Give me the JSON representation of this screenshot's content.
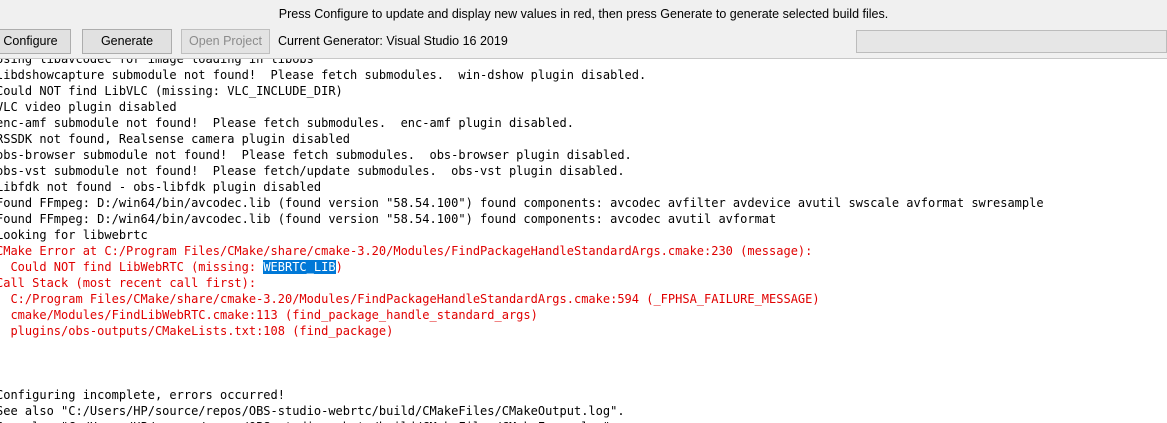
{
  "hint": "Press Configure to update and display new values in red, then press Generate to generate selected build files.",
  "toolbar": {
    "configure_label": "Configure",
    "generate_label": "Generate",
    "open_project_label": "Open Project",
    "current_generator": "Current Generator: Visual Studio 16 2019",
    "progress": 0
  },
  "output": {
    "lines": [
      {
        "text": "Using libavcodec for image loading in libobs",
        "style": "normal"
      },
      {
        "text": "libdshowcapture submodule not found!  Please fetch submodules.  win-dshow plugin disabled.",
        "style": "normal"
      },
      {
        "text": "Could NOT find LibVLC (missing: VLC_INCLUDE_DIR)",
        "style": "normal"
      },
      {
        "text": "VLC video plugin disabled",
        "style": "normal"
      },
      {
        "text": "enc-amf submodule not found!  Please fetch submodules.  enc-amf plugin disabled.",
        "style": "normal"
      },
      {
        "text": "RSSDK not found, Realsense camera plugin disabled",
        "style": "normal"
      },
      {
        "text": "obs-browser submodule not found!  Please fetch submodules.  obs-browser plugin disabled.",
        "style": "normal"
      },
      {
        "text": "obs-vst submodule not found!  Please fetch/update submodules.  obs-vst plugin disabled.",
        "style": "normal"
      },
      {
        "text": "Libfdk not found - obs-libfdk plugin disabled",
        "style": "normal"
      },
      {
        "text": "Found FFmpeg: D:/win64/bin/avcodec.lib (found version \"58.54.100\") found components: avcodec avfilter avdevice avutil swscale avformat swresample",
        "style": "normal"
      },
      {
        "text": "Found FFmpeg: D:/win64/bin/avcodec.lib (found version \"58.54.100\") found components: avcodec avutil avformat",
        "style": "normal"
      },
      {
        "text": "Looking for libwebrtc",
        "style": "normal"
      },
      {
        "text": "CMake Error at C:/Program Files/CMake/share/cmake-3.20/Modules/FindPackageHandleStandardArgs.cmake:230 (message):",
        "style": "error"
      },
      {
        "text": "  Could NOT find LibWebRTC (missing: ",
        "selected": "WEBRTC_LIB",
        "after": ")",
        "style": "error"
      },
      {
        "text": "Call Stack (most recent call first):",
        "style": "error"
      },
      {
        "text": "  C:/Program Files/CMake/share/cmake-3.20/Modules/FindPackageHandleStandardArgs.cmake:594 (_FPHSA_FAILURE_MESSAGE)",
        "style": "error"
      },
      {
        "text": "  cmake/Modules/FindLibWebRTC.cmake:113 (find_package_handle_standard_args)",
        "style": "error"
      },
      {
        "text": "  plugins/obs-outputs/CMakeLists.txt:108 (find_package)",
        "style": "error"
      },
      {
        "text": "",
        "style": "normal"
      },
      {
        "text": "",
        "style": "normal"
      },
      {
        "text": "",
        "style": "normal"
      },
      {
        "text": "Configuring incomplete, errors occurred!",
        "style": "normal"
      },
      {
        "text": "See also \"C:/Users/HP/source/repos/OBS-studio-webrtc/build/CMakeFiles/CMakeOutput.log\".",
        "style": "normal"
      },
      {
        "text": "See also \"C:/Users/HP/source/repos/OBS-studio-webrtc/build/CMakeFiles/CMakeError.log\".",
        "style": "normal"
      }
    ]
  }
}
